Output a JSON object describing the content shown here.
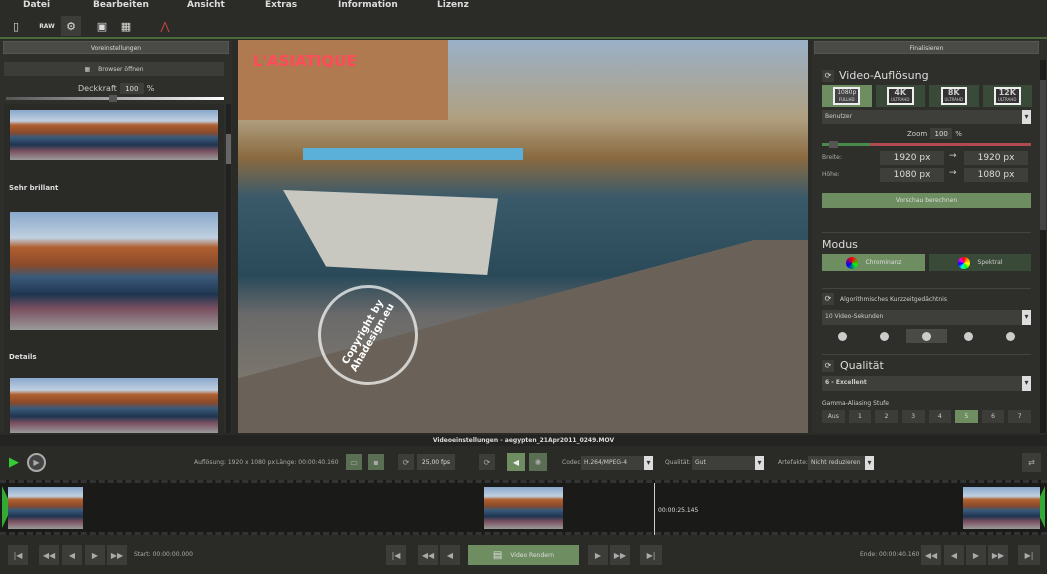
{
  "menu": [
    "Datei",
    "Bearbeiten",
    "Ansicht",
    "Extras",
    "Information",
    "Lizenz"
  ],
  "toolbar": {
    "raw": "RAW"
  },
  "left": {
    "title": "Voreinstellungen",
    "browser": "Browser öffnen",
    "opacity_label": "Deckkraft",
    "opacity": "100",
    "pct": "%",
    "opacity_level": 0.5,
    "presets": [
      {
        "label": ""
      },
      {
        "label": "Sehr brillant"
      },
      {
        "label": "Details"
      }
    ]
  },
  "video": {
    "sign": "L'ASIATIQUE",
    "watermark": "Copyright by Ahadesign.eu"
  },
  "right": {
    "title": "Finalisieren",
    "res_title": "Video-Auflösung",
    "res_buttons": [
      {
        "big": "1080p",
        "small": "FULLHD"
      },
      {
        "big": "4K",
        "small": "ULTRAHD"
      },
      {
        "big": "8K",
        "small": "ULTRAHD"
      },
      {
        "big": "12K",
        "small": "ULTRAHD"
      }
    ],
    "preset": "Benutzer",
    "zoom_label": "Zoom",
    "zoom": "100",
    "pct": "%",
    "width_label": "Breite:",
    "height_label": "Höhe:",
    "w_in": "1920 px",
    "w_out": "1920 px",
    "h_in": "1080 px",
    "h_out": "1080 px",
    "arrow": "→",
    "preview": "Vorschau berechnen",
    "mode_title": "Modus",
    "mode_chroma": "Chrominanz",
    "mode_spectral": "Spektral",
    "memory_label": "Algorithmisches Kurzzeitgedächtnis",
    "memory_value": "10 Video-Sekunden",
    "quality_title": "Qualität",
    "quality_value": "6 - Excellent",
    "gamma_label": "Gamma-Aliasing Stufe",
    "gamma": [
      "Aus",
      "1",
      "2",
      "3",
      "4",
      "5",
      "6",
      "7"
    ],
    "gamma_selected": "5"
  },
  "settings": {
    "title": "Videoeinstellungen - aegypten_21Apr2011_0249.MOV",
    "resolution": "Auflösung: 1920 x 1080 px",
    "length": "Länge: 00:00:40.160",
    "fps": "25,00 fps",
    "codec_label": "Codec:",
    "codec": "H.264/MPEG-4",
    "quality_label": "Qualität:",
    "quality": "Gut",
    "artifacts_label": "Artefakte:",
    "artifacts": "Nicht reduzieren"
  },
  "timeline": {
    "playhead": "00:00:25.145"
  },
  "bottom": {
    "start": "Start: 00:00:00.000",
    "render": "Video Rendern",
    "end": "Ende: 00:00:40.160"
  },
  "colors": {
    "accent": "#6e8e62",
    "bg": "#2a2a27"
  }
}
